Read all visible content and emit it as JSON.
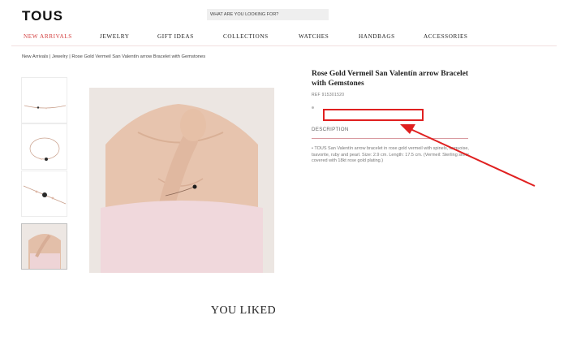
{
  "header": {
    "logo": "TOUS",
    "search_placeholder": "WHAT ARE YOU LOOKING FOR?"
  },
  "nav": {
    "items": [
      "NEW ARRIVALS",
      "JEWELRY",
      "GIFT IDEAS",
      "COLLECTIONS",
      "WATCHES",
      "HANDBAGS",
      "ACCESSORIES"
    ],
    "active_index": 0,
    "active_color": "#d23b3b"
  },
  "breadcrumb": "New Arrivals | Jewelry | Rose Gold Vermeil San Valentín arrow Bracelet with Gemstones",
  "product": {
    "title": "Rose Gold Vermeil San Valentín arrow Bracelet with Gemstones",
    "ref_label": "REF",
    "ref_value": "915301520",
    "description_tab": "DESCRIPTION",
    "description_text": "• TOUS San Valentín arrow bracelet in rose gold vermeil with spinels, turquoise, tsavorite, ruby and pearl. Size: 2.9 cm. Length: 17.5 cm. (Vermeil: Sterling silver covered with 18kt rose gold plating.)"
  },
  "annotation": {
    "color": "#e02020"
  },
  "section": {
    "you_liked": "YOU LIKED"
  }
}
